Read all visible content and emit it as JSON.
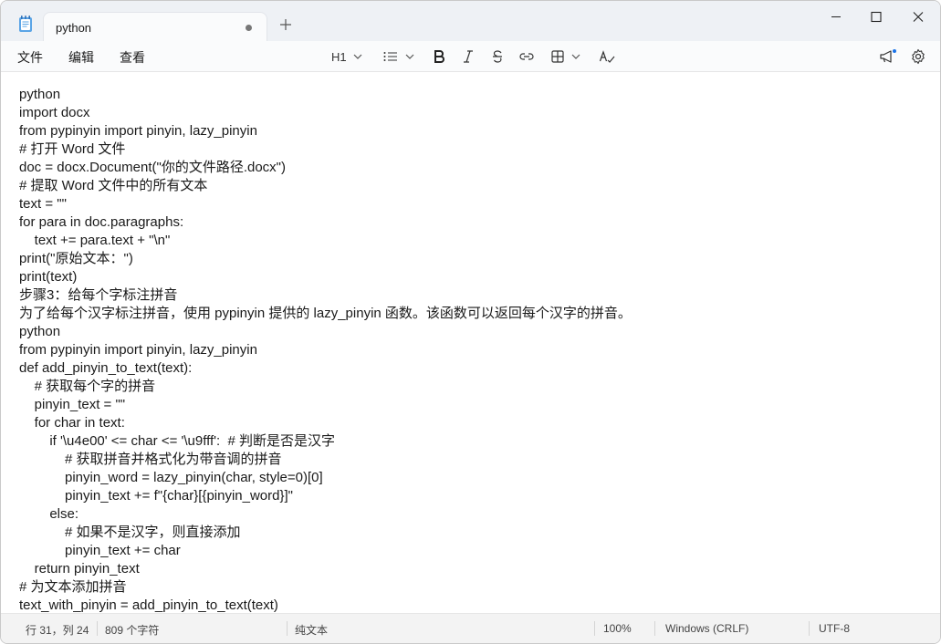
{
  "tab": {
    "title": "python"
  },
  "menu": {
    "file": "文件",
    "edit": "编辑",
    "view": "查看"
  },
  "toolbar": {
    "heading": "H1"
  },
  "editor": {
    "lines": [
      "python",
      "import docx",
      "from pypinyin import pinyin, lazy_pinyin",
      "# 打开 Word 文件",
      "doc = docx.Document(\"你的文件路径.docx\")",
      "# 提取 Word 文件中的所有文本",
      "text = \"\"",
      "for para in doc.paragraphs:",
      "    text += para.text + \"\\n\"",
      "print(\"原始文本：\")",
      "print(text)",
      "步骤3：给每个字标注拼音",
      "为了给每个汉字标注拼音，使用 pypinyin 提供的 lazy_pinyin 函数。该函数可以返回每个汉字的拼音。",
      "python",
      "from pypinyin import pinyin, lazy_pinyin",
      "def add_pinyin_to_text(text):",
      "    # 获取每个字的拼音",
      "    pinyin_text = \"\"",
      "    for char in text:",
      "        if '\\u4e00' <= char <= '\\u9fff':  # 判断是否是汉字",
      "            # 获取拼音并格式化为带音调的拼音",
      "            pinyin_word = lazy_pinyin(char, style=0)[0]",
      "            pinyin_text += f\"{char}[{pinyin_word}]\"",
      "        else:",
      "            # 如果不是汉字，则直接添加",
      "            pinyin_text += char",
      "    return pinyin_text",
      "# 为文本添加拼音",
      "text_with_pinyin = add_pinyin_to_text(text)"
    ]
  },
  "status": {
    "position": "行 31，列 24",
    "chars": "809 个字符",
    "format": "纯文本",
    "zoom": "100%",
    "line_ending": "Windows (CRLF)",
    "encoding": "UTF-8"
  }
}
